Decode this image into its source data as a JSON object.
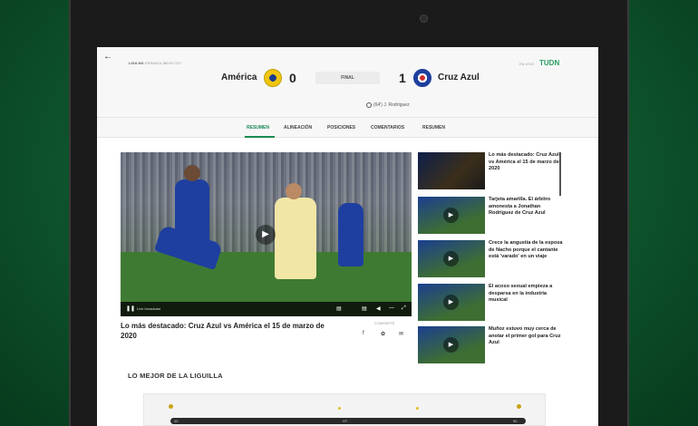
{
  "header": {
    "league": "LIGA MX",
    "date": "JORNADA 10",
    "time": "12:00 CDT",
    "home_team": "América",
    "home_score": "0",
    "status": "FINAL",
    "away_score": "1",
    "away_team": "Cruz Azul",
    "scorer": "(64') J. Rodríguez",
    "brand_pre": "EN VIVO",
    "brand": "TUDN"
  },
  "tabs": [
    "RESUMEN",
    "ALINEACIÓN",
    "POSICIONES",
    "COMENTARIOS",
    "RESUMEN"
  ],
  "video": {
    "live_text": "Live broadcast",
    "title": "Lo más destacado: Cruz Azul vs América el 15 de marzo de 2020",
    "share_label": "COMPARTE"
  },
  "sidebar": [
    {
      "title": "Lo más destacado: Cruz Azul vs América el 15 de marzo de 2020"
    },
    {
      "title": "Tarjeta amarilla. El árbitro amonesta a Jonathan Rodríguez de Cruz Azul"
    },
    {
      "title": "Crece la angustia de la esposa de Nacho porque el cantante está 'varado' en un viaje"
    },
    {
      "title": "El acoso sexual empieza a desparsa en la industria musical"
    },
    {
      "title": "Muñoz estuvo muy cerca de anotar el primer gol para Cruz Azul"
    }
  ],
  "bottom": {
    "section_title": "LO MEJOR DE LA LIGUILLA",
    "tl_start": "00",
    "tl_mid": "HT",
    "tl_end": "90"
  },
  "colors": {
    "accent": "#1a8a52",
    "brand": "#2a9d62",
    "home_crest": "#f1c40f",
    "away_crest": "#1d3f9e"
  }
}
